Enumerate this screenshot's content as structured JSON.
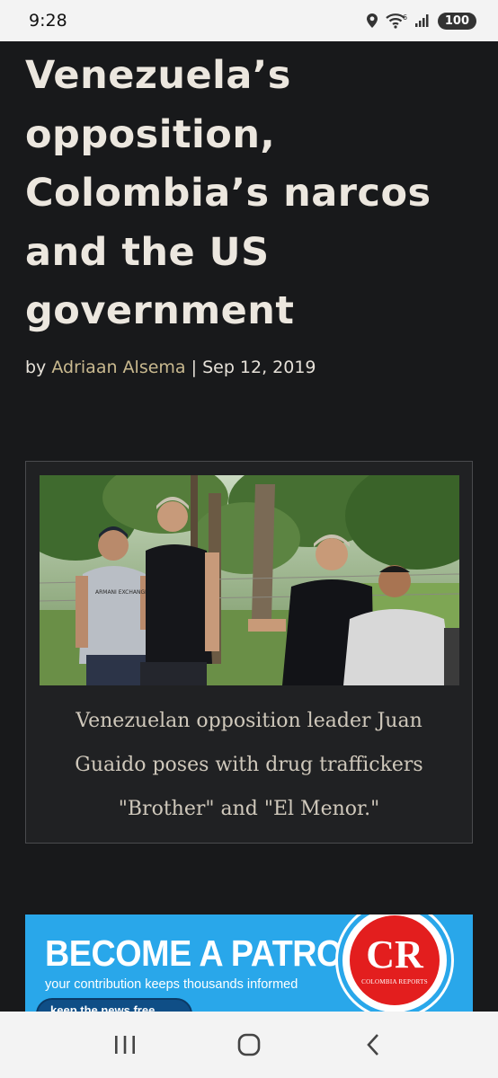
{
  "status_bar": {
    "time": "9:28",
    "battery": "100",
    "icons": [
      "location-icon",
      "wifi-icon",
      "signal-icon",
      "battery-icon"
    ]
  },
  "article": {
    "title": "Venezuela’s opposition, Colombia’s narcos and the US government",
    "byline_prefix": "by",
    "author": "Adriaan Alsema",
    "separator": "|",
    "date": "Sep 12, 2019"
  },
  "figure": {
    "caption": "Venezuelan opposition leader Juan Guaido poses with drug traffickers \"Brother\" and \"El Menor.\"",
    "shirt_text": "ARMANI EXCHANGE"
  },
  "ad": {
    "headline": "BECOME A PATRON",
    "subtext": "your contribution keeps thousands informed",
    "button": "keep the news free",
    "logo_text": "CR",
    "logo_subtext": "COLOMBIA REPORTS"
  },
  "nav_bar": {
    "buttons": [
      "recent-apps-icon",
      "home-icon",
      "back-icon"
    ]
  },
  "colors": {
    "background": "#18191b",
    "title": "#ece7df",
    "author": "#c9b98f",
    "ad_background": "#29a7ea",
    "logo_red": "#e31e1e"
  }
}
